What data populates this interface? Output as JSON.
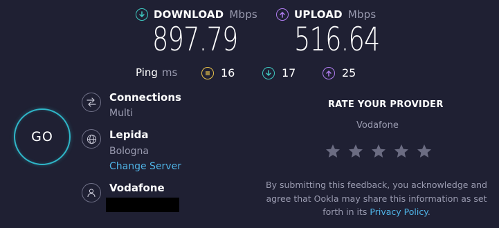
{
  "download": {
    "label": "DOWNLOAD",
    "unit": "Mbps",
    "value": "897.79",
    "icon": "download-arrow-icon",
    "color": "#3fc9c2"
  },
  "upload": {
    "label": "UPLOAD",
    "unit": "Mbps",
    "value": "516.64",
    "icon": "upload-arrow-icon",
    "color": "#b07cf0"
  },
  "ping": {
    "label": "Ping",
    "unit": "ms",
    "idle": {
      "value": "16",
      "icon": "idle-latency-icon",
      "color": "#e8c14a"
    },
    "download": {
      "value": "17",
      "icon": "download-latency-icon",
      "color": "#3fc9c2"
    },
    "upload": {
      "value": "25",
      "icon": "upload-latency-icon",
      "color": "#b07cf0"
    }
  },
  "go_button": {
    "label": "GO"
  },
  "connections": {
    "title": "Connections",
    "value": "Multi",
    "icon": "connections-icon"
  },
  "server": {
    "name": "Lepida",
    "location": "Bologna",
    "change_label": "Change Server",
    "icon": "globe-icon"
  },
  "provider": {
    "name": "Vodafone",
    "icon": "user-icon"
  },
  "rate": {
    "title": "RATE YOUR PROVIDER",
    "provider": "Vodafone",
    "stars": 5,
    "disclaimer_pre": "By submitting this feedback, you acknowledge and agree that Ookla may share this information as set forth in its ",
    "privacy_link": "Privacy Policy",
    "disclaimer_post": "."
  },
  "colors": {
    "background": "#1f2033",
    "accent": "#2fb6c8",
    "link": "#4fb3e6",
    "star": "#6b6c82"
  }
}
